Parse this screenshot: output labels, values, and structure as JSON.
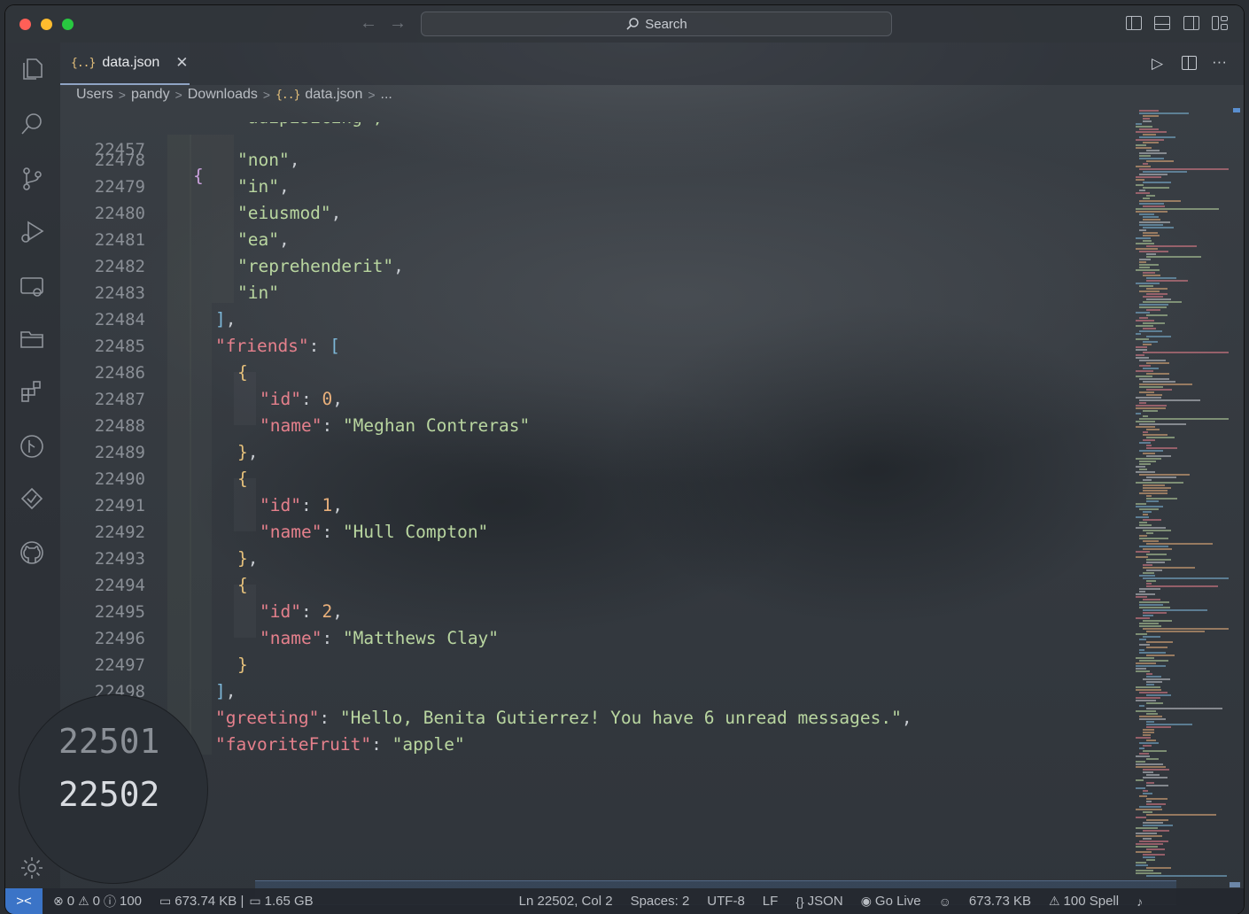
{
  "titlebar": {
    "search_label": "Search",
    "back_glyph": "←",
    "forward_glyph": "→"
  },
  "tab": {
    "label": "data.json",
    "icon_glyph": "{..}",
    "close_glyph": "✕"
  },
  "tab_actions": {
    "run_glyph": "▷",
    "more_glyph": "···"
  },
  "breadcrumb": {
    "items": [
      "Users",
      "pandy",
      "Downloads",
      "data.json",
      "..."
    ],
    "separator": ">"
  },
  "editor": {
    "first_line_number": "22457",
    "first_line_text": "{",
    "partial_line": "\"adipisicing\",",
    "lines": [
      {
        "ln": "22478",
        "indent": 2,
        "tokens": [
          [
            "s",
            "\"non\""
          ],
          [
            "p",
            ","
          ]
        ]
      },
      {
        "ln": "22479",
        "indent": 2,
        "tokens": [
          [
            "s",
            "\"in\""
          ],
          [
            "p",
            ","
          ]
        ]
      },
      {
        "ln": "22480",
        "indent": 2,
        "tokens": [
          [
            "s",
            "\"eiusmod\""
          ],
          [
            "p",
            ","
          ]
        ]
      },
      {
        "ln": "22481",
        "indent": 2,
        "tokens": [
          [
            "s",
            "\"ea\""
          ],
          [
            "p",
            ","
          ]
        ]
      },
      {
        "ln": "22482",
        "indent": 2,
        "tokens": [
          [
            "s",
            "\"reprehenderit\""
          ],
          [
            "p",
            ","
          ]
        ]
      },
      {
        "ln": "22483",
        "indent": 2,
        "tokens": [
          [
            "s",
            "\"in\""
          ]
        ]
      },
      {
        "ln": "22484",
        "indent": 1,
        "tokens": [
          [
            "b2",
            "]"
          ],
          [
            "p",
            ","
          ]
        ]
      },
      {
        "ln": "22485",
        "indent": 1,
        "tokens": [
          [
            "k",
            "\"friends\""
          ],
          [
            "p",
            ": "
          ],
          [
            "b2",
            "["
          ]
        ]
      },
      {
        "ln": "22486",
        "indent": 2,
        "tokens": [
          [
            "b3",
            "{"
          ]
        ]
      },
      {
        "ln": "22487",
        "indent": 3,
        "tokens": [
          [
            "k",
            "\"id\""
          ],
          [
            "p",
            ": "
          ],
          [
            "n",
            "0"
          ],
          [
            "p",
            ","
          ]
        ]
      },
      {
        "ln": "22488",
        "indent": 3,
        "tokens": [
          [
            "k",
            "\"name\""
          ],
          [
            "p",
            ": "
          ],
          [
            "s",
            "\"Meghan Contreras\""
          ]
        ]
      },
      {
        "ln": "22489",
        "indent": 2,
        "tokens": [
          [
            "b3",
            "}"
          ],
          [
            "p",
            ","
          ]
        ]
      },
      {
        "ln": "22490",
        "indent": 2,
        "tokens": [
          [
            "b3",
            "{"
          ]
        ]
      },
      {
        "ln": "22491",
        "indent": 3,
        "tokens": [
          [
            "k",
            "\"id\""
          ],
          [
            "p",
            ": "
          ],
          [
            "n",
            "1"
          ],
          [
            "p",
            ","
          ]
        ]
      },
      {
        "ln": "22492",
        "indent": 3,
        "tokens": [
          [
            "k",
            "\"name\""
          ],
          [
            "p",
            ": "
          ],
          [
            "s",
            "\"Hull Compton\""
          ]
        ]
      },
      {
        "ln": "22493",
        "indent": 2,
        "tokens": [
          [
            "b3",
            "}"
          ],
          [
            "p",
            ","
          ]
        ]
      },
      {
        "ln": "22494",
        "indent": 2,
        "tokens": [
          [
            "b3",
            "{"
          ]
        ]
      },
      {
        "ln": "22495",
        "indent": 3,
        "tokens": [
          [
            "k",
            "\"id\""
          ],
          [
            "p",
            ": "
          ],
          [
            "n",
            "2"
          ],
          [
            "p",
            ","
          ]
        ]
      },
      {
        "ln": "22496",
        "indent": 3,
        "tokens": [
          [
            "k",
            "\"name\""
          ],
          [
            "p",
            ": "
          ],
          [
            "s",
            "\"Matthews Clay\""
          ]
        ]
      },
      {
        "ln": "22497",
        "indent": 2,
        "tokens": [
          [
            "b3",
            "}"
          ]
        ]
      },
      {
        "ln": "22498",
        "indent": 1,
        "tokens": [
          [
            "b2",
            "]"
          ],
          [
            "p",
            ","
          ]
        ]
      },
      {
        "ln": "",
        "indent": 1,
        "tokens": [
          [
            "k",
            "\"greeting\""
          ],
          [
            "p",
            ": "
          ],
          [
            "s",
            "\"Hello, Benita Gutierrez! You have 6 unread messages.\""
          ],
          [
            "p",
            ","
          ]
        ]
      },
      {
        "ln": "",
        "indent": 1,
        "tokens": [
          [
            "k",
            "\"favoriteFruit\""
          ],
          [
            "p",
            ": "
          ],
          [
            "s",
            "\"apple\""
          ]
        ]
      }
    ]
  },
  "magnifier": {
    "line_a": "22501",
    "line_b": "22502"
  },
  "statusbar": {
    "remote_glyph": "><",
    "errors": "0",
    "warnings": "0",
    "infos": "100",
    "file_size": "673.74 KB |",
    "memory": "1.65 GB",
    "cursor": "Ln 22502, Col 2",
    "spaces": "Spaces: 2",
    "encoding": "UTF-8",
    "eol": "LF",
    "language": "JSON",
    "go_live": "Go Live",
    "size2": "673.73 KB",
    "spell": "100 Spell"
  },
  "colors": {
    "accent": "#3b74c7",
    "key": "#e5808c",
    "string": "#b9d6a0",
    "number": "#e9b07b"
  }
}
